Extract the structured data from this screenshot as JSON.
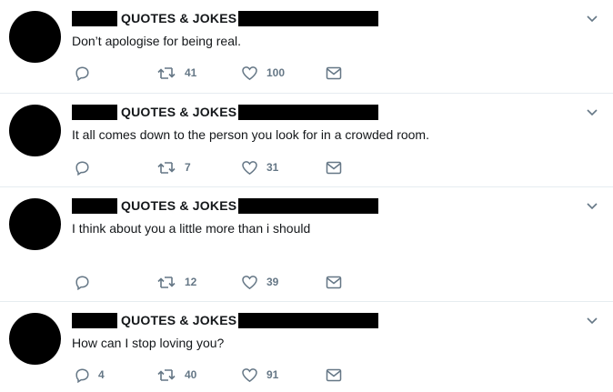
{
  "tweets": [
    {
      "account": "QUOTES & JOKES",
      "text": "Don’t apologise for being real.",
      "replies": "",
      "retweets": "41",
      "likes": "100"
    },
    {
      "account": "QUOTES & JOKES",
      "text": "It all comes down to the person you look for in a crowded room.",
      "replies": "",
      "retweets": "7",
      "likes": "31"
    },
    {
      "account": "QUOTES & JOKES",
      "text": "I think about you a little more than i should",
      "replies": "",
      "retweets": "12",
      "likes": "39"
    },
    {
      "account": "QUOTES & JOKES",
      "text": "How can I stop loving you?",
      "replies": "4",
      "retweets": "40",
      "likes": "91"
    }
  ],
  "icons": {
    "reply": "reply-icon",
    "retweet": "retweet-icon",
    "like": "heart-icon",
    "message": "envelope-icon",
    "menu": "chevron-down-icon",
    "avatar": "avatar"
  },
  "colors": {
    "icon_gray": "#657786",
    "divider": "#e6ecf0",
    "redaction": "#000000"
  }
}
